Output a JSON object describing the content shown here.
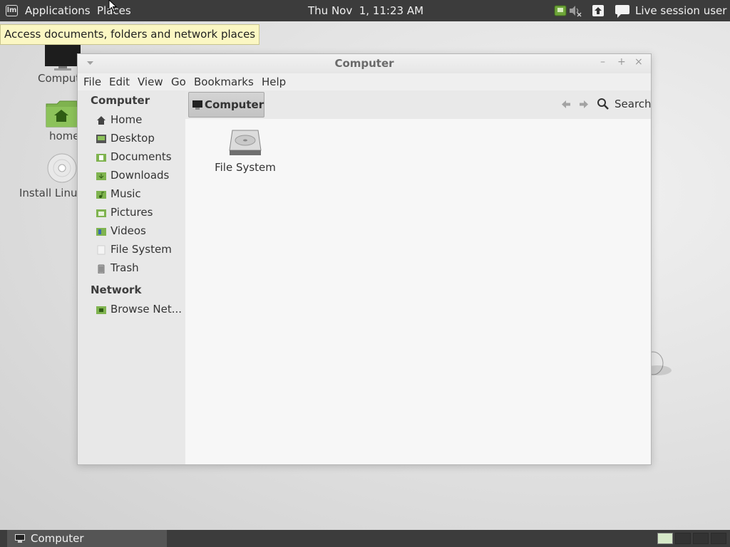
{
  "top_panel": {
    "applications_label": "Applications",
    "places_label": "Places",
    "clock": "Thu Nov  1, 11:23 AM",
    "user_label": "Live session user"
  },
  "tooltip": {
    "text": "Access documents, folders and network places"
  },
  "desktop": {
    "icons": [
      {
        "label": "Computer",
        "icon": "monitor-icon"
      },
      {
        "label": "home",
        "icon": "home-folder-icon"
      },
      {
        "label": "Install Linux Mint",
        "icon": "disc-icon"
      }
    ]
  },
  "window": {
    "title": "Computer",
    "menu": [
      "File",
      "Edit",
      "View",
      "Go",
      "Bookmarks",
      "Help"
    ],
    "sidebar": {
      "computer_heading": "Computer",
      "items": [
        {
          "label": "Home",
          "icon": "home-icon"
        },
        {
          "label": "Desktop",
          "icon": "desktop-icon"
        },
        {
          "label": "Documents",
          "icon": "documents-folder-icon"
        },
        {
          "label": "Downloads",
          "icon": "downloads-folder-icon"
        },
        {
          "label": "Music",
          "icon": "music-folder-icon"
        },
        {
          "label": "Pictures",
          "icon": "pictures-folder-icon"
        },
        {
          "label": "Videos",
          "icon": "videos-folder-icon"
        },
        {
          "label": "File System",
          "icon": "filesystem-icon"
        },
        {
          "label": "Trash",
          "icon": "trash-icon"
        }
      ],
      "network_heading": "Network",
      "network_items": [
        {
          "label": "Browse Net...",
          "icon": "network-folder-icon"
        }
      ]
    },
    "toolbar": {
      "path_label": "Computer",
      "search_label": "Search"
    },
    "content": {
      "items": [
        {
          "label": "File System",
          "icon": "harddisk-icon"
        }
      ]
    }
  },
  "taskbar": {
    "task_label": "Computer"
  },
  "colors": {
    "panel": "#3c3c3c",
    "tooltip_bg": "#fbf7c3",
    "folder_green": "#7fb34f",
    "accent_workspace": "#d6e8c8"
  }
}
